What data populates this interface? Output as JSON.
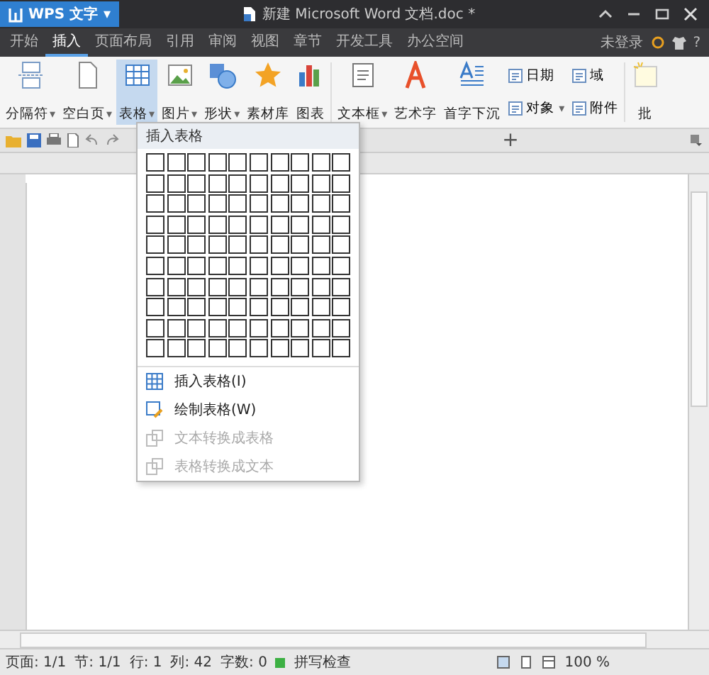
{
  "app_button": {
    "label": "WPS 文字",
    "caret": "▾"
  },
  "window": {
    "title": "新建 Microsoft Word 文档.doc *"
  },
  "tabs": [
    {
      "label": "开始",
      "selected": false
    },
    {
      "label": "插入",
      "selected": true
    },
    {
      "label": "页面布局",
      "selected": false
    },
    {
      "label": "引用",
      "selected": false
    },
    {
      "label": "审阅",
      "selected": false
    },
    {
      "label": "视图",
      "selected": false
    },
    {
      "label": "章节",
      "selected": false
    },
    {
      "label": "开发工具",
      "selected": false
    },
    {
      "label": "办公空间",
      "selected": false
    }
  ],
  "account": {
    "label": "未登录",
    "help": "?"
  },
  "ribbon": [
    {
      "kind": "big",
      "label": "分隔符",
      "caret": "▾",
      "selected": false
    },
    {
      "kind": "big",
      "label": "空白页",
      "caret": "▾",
      "selected": false
    },
    {
      "kind": "big",
      "label": "表格",
      "caret": "▾",
      "selected": true
    },
    {
      "kind": "big",
      "label": "图片",
      "caret": "▾",
      "selected": false
    },
    {
      "kind": "big",
      "label": "形状",
      "caret": "▾",
      "selected": false
    },
    {
      "kind": "big",
      "label": "素材库",
      "selected": false
    },
    {
      "kind": "big",
      "label": "图表",
      "selected": false
    },
    {
      "kind": "big",
      "label": "文本框",
      "caret": "▾",
      "selected": false
    },
    {
      "kind": "big",
      "label": "艺术字",
      "selected": false
    },
    {
      "kind": "big",
      "label": "首字下沉",
      "selected": false
    },
    {
      "kind": "small",
      "top": {
        "label": "日期"
      },
      "bottom": {
        "label": "对象",
        "caret": "▾"
      }
    },
    {
      "kind": "small",
      "top": {
        "label": "域"
      },
      "bottom": {
        "label": "附件"
      }
    },
    {
      "kind": "big",
      "label": "批",
      "selected": false
    }
  ],
  "table_menu": {
    "header": "插入表格",
    "items": [
      {
        "label": "插入表格(I)",
        "disabled": false
      },
      {
        "label": "绘制表格(W)",
        "disabled": false
      },
      {
        "label": "文本转换成表格",
        "disabled": true
      },
      {
        "label": "表格转换成文本",
        "disabled": true
      }
    ]
  },
  "doc_tab_add": "+",
  "status_bar": {
    "fields": [
      "页面: 1/1",
      "节: 1/1",
      "行: 1",
      "列: 42",
      "字数: 0"
    ],
    "spell": {
      "label": "拼写检查",
      "on": true
    },
    "zoom": "100 %"
  }
}
